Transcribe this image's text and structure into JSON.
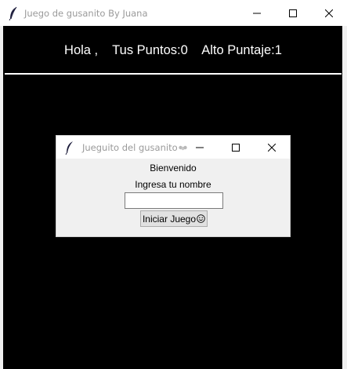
{
  "main_window": {
    "title": "Juego de gusanito By Juana",
    "icon": "feather-icon",
    "controls": [
      "minimize-icon",
      "maximize-icon",
      "close-icon"
    ]
  },
  "score_bar": {
    "text": "Hola ,    Tus Puntos:0    Alto Puntaje:1"
  },
  "dialog": {
    "title": "Jueguito del gusanito",
    "title_emoji": "worm-icon",
    "welcome": "Bienvenido",
    "prompt": "Ingresa tu nombre",
    "name_value": "",
    "start_button": "Iniciar Juego",
    "start_emoji": "smiley-icon"
  },
  "colors": {
    "canvas": "#000000",
    "score_text": "#ffffff",
    "dialog_bg": "#f0f0f0"
  }
}
